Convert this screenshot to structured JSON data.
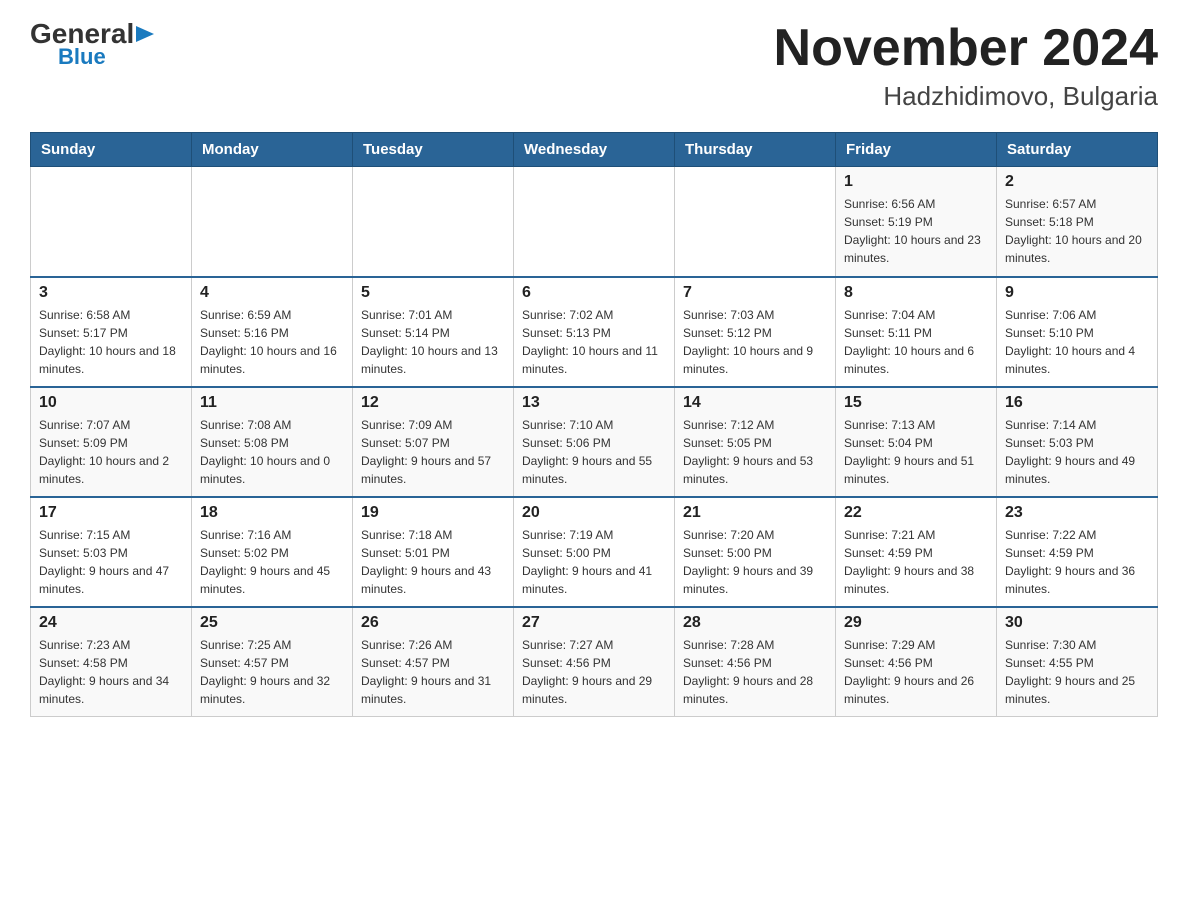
{
  "logo": {
    "general": "General",
    "blue": "Blue",
    "triangle": "▶"
  },
  "title": "November 2024",
  "subtitle": "Hadzhidimovo, Bulgaria",
  "weekdays": [
    "Sunday",
    "Monday",
    "Tuesday",
    "Wednesday",
    "Thursday",
    "Friday",
    "Saturday"
  ],
  "weeks": [
    [
      {
        "day": "",
        "info": ""
      },
      {
        "day": "",
        "info": ""
      },
      {
        "day": "",
        "info": ""
      },
      {
        "day": "",
        "info": ""
      },
      {
        "day": "",
        "info": ""
      },
      {
        "day": "1",
        "info": "Sunrise: 6:56 AM\nSunset: 5:19 PM\nDaylight: 10 hours and 23 minutes."
      },
      {
        "day": "2",
        "info": "Sunrise: 6:57 AM\nSunset: 5:18 PM\nDaylight: 10 hours and 20 minutes."
      }
    ],
    [
      {
        "day": "3",
        "info": "Sunrise: 6:58 AM\nSunset: 5:17 PM\nDaylight: 10 hours and 18 minutes."
      },
      {
        "day": "4",
        "info": "Sunrise: 6:59 AM\nSunset: 5:16 PM\nDaylight: 10 hours and 16 minutes."
      },
      {
        "day": "5",
        "info": "Sunrise: 7:01 AM\nSunset: 5:14 PM\nDaylight: 10 hours and 13 minutes."
      },
      {
        "day": "6",
        "info": "Sunrise: 7:02 AM\nSunset: 5:13 PM\nDaylight: 10 hours and 11 minutes."
      },
      {
        "day": "7",
        "info": "Sunrise: 7:03 AM\nSunset: 5:12 PM\nDaylight: 10 hours and 9 minutes."
      },
      {
        "day": "8",
        "info": "Sunrise: 7:04 AM\nSunset: 5:11 PM\nDaylight: 10 hours and 6 minutes."
      },
      {
        "day": "9",
        "info": "Sunrise: 7:06 AM\nSunset: 5:10 PM\nDaylight: 10 hours and 4 minutes."
      }
    ],
    [
      {
        "day": "10",
        "info": "Sunrise: 7:07 AM\nSunset: 5:09 PM\nDaylight: 10 hours and 2 minutes."
      },
      {
        "day": "11",
        "info": "Sunrise: 7:08 AM\nSunset: 5:08 PM\nDaylight: 10 hours and 0 minutes."
      },
      {
        "day": "12",
        "info": "Sunrise: 7:09 AM\nSunset: 5:07 PM\nDaylight: 9 hours and 57 minutes."
      },
      {
        "day": "13",
        "info": "Sunrise: 7:10 AM\nSunset: 5:06 PM\nDaylight: 9 hours and 55 minutes."
      },
      {
        "day": "14",
        "info": "Sunrise: 7:12 AM\nSunset: 5:05 PM\nDaylight: 9 hours and 53 minutes."
      },
      {
        "day": "15",
        "info": "Sunrise: 7:13 AM\nSunset: 5:04 PM\nDaylight: 9 hours and 51 minutes."
      },
      {
        "day": "16",
        "info": "Sunrise: 7:14 AM\nSunset: 5:03 PM\nDaylight: 9 hours and 49 minutes."
      }
    ],
    [
      {
        "day": "17",
        "info": "Sunrise: 7:15 AM\nSunset: 5:03 PM\nDaylight: 9 hours and 47 minutes."
      },
      {
        "day": "18",
        "info": "Sunrise: 7:16 AM\nSunset: 5:02 PM\nDaylight: 9 hours and 45 minutes."
      },
      {
        "day": "19",
        "info": "Sunrise: 7:18 AM\nSunset: 5:01 PM\nDaylight: 9 hours and 43 minutes."
      },
      {
        "day": "20",
        "info": "Sunrise: 7:19 AM\nSunset: 5:00 PM\nDaylight: 9 hours and 41 minutes."
      },
      {
        "day": "21",
        "info": "Sunrise: 7:20 AM\nSunset: 5:00 PM\nDaylight: 9 hours and 39 minutes."
      },
      {
        "day": "22",
        "info": "Sunrise: 7:21 AM\nSunset: 4:59 PM\nDaylight: 9 hours and 38 minutes."
      },
      {
        "day": "23",
        "info": "Sunrise: 7:22 AM\nSunset: 4:59 PM\nDaylight: 9 hours and 36 minutes."
      }
    ],
    [
      {
        "day": "24",
        "info": "Sunrise: 7:23 AM\nSunset: 4:58 PM\nDaylight: 9 hours and 34 minutes."
      },
      {
        "day": "25",
        "info": "Sunrise: 7:25 AM\nSunset: 4:57 PM\nDaylight: 9 hours and 32 minutes."
      },
      {
        "day": "26",
        "info": "Sunrise: 7:26 AM\nSunset: 4:57 PM\nDaylight: 9 hours and 31 minutes."
      },
      {
        "day": "27",
        "info": "Sunrise: 7:27 AM\nSunset: 4:56 PM\nDaylight: 9 hours and 29 minutes."
      },
      {
        "day": "28",
        "info": "Sunrise: 7:28 AM\nSunset: 4:56 PM\nDaylight: 9 hours and 28 minutes."
      },
      {
        "day": "29",
        "info": "Sunrise: 7:29 AM\nSunset: 4:56 PM\nDaylight: 9 hours and 26 minutes."
      },
      {
        "day": "30",
        "info": "Sunrise: 7:30 AM\nSunset: 4:55 PM\nDaylight: 9 hours and 25 minutes."
      }
    ]
  ]
}
